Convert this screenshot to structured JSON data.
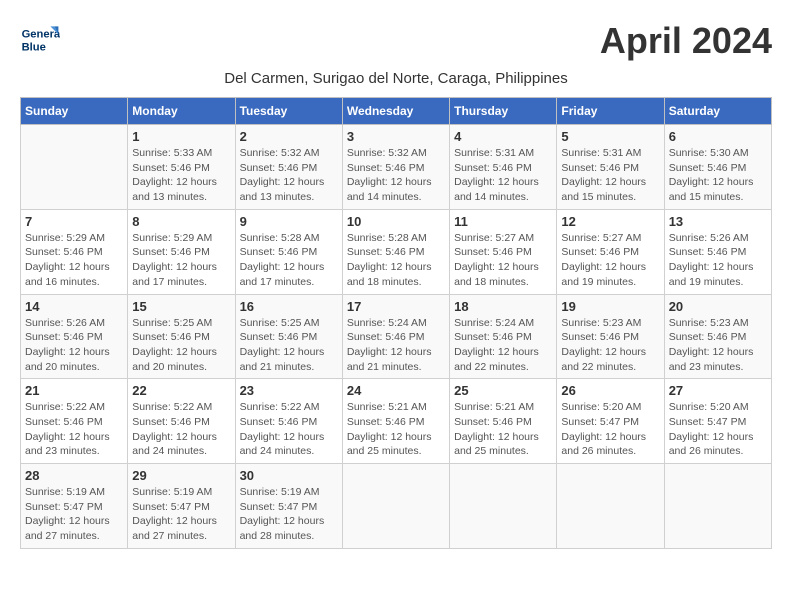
{
  "header": {
    "logo_line1": "General",
    "logo_line2": "Blue",
    "month_title": "April 2024",
    "location": "Del Carmen, Surigao del Norte, Caraga, Philippines"
  },
  "weekdays": [
    "Sunday",
    "Monday",
    "Tuesday",
    "Wednesday",
    "Thursday",
    "Friday",
    "Saturday"
  ],
  "weeks": [
    [
      {
        "day": "",
        "info": ""
      },
      {
        "day": "1",
        "info": "Sunrise: 5:33 AM\nSunset: 5:46 PM\nDaylight: 12 hours\nand 13 minutes."
      },
      {
        "day": "2",
        "info": "Sunrise: 5:32 AM\nSunset: 5:46 PM\nDaylight: 12 hours\nand 13 minutes."
      },
      {
        "day": "3",
        "info": "Sunrise: 5:32 AM\nSunset: 5:46 PM\nDaylight: 12 hours\nand 14 minutes."
      },
      {
        "day": "4",
        "info": "Sunrise: 5:31 AM\nSunset: 5:46 PM\nDaylight: 12 hours\nand 14 minutes."
      },
      {
        "day": "5",
        "info": "Sunrise: 5:31 AM\nSunset: 5:46 PM\nDaylight: 12 hours\nand 15 minutes."
      },
      {
        "day": "6",
        "info": "Sunrise: 5:30 AM\nSunset: 5:46 PM\nDaylight: 12 hours\nand 15 minutes."
      }
    ],
    [
      {
        "day": "7",
        "info": "Sunrise: 5:29 AM\nSunset: 5:46 PM\nDaylight: 12 hours\nand 16 minutes."
      },
      {
        "day": "8",
        "info": "Sunrise: 5:29 AM\nSunset: 5:46 PM\nDaylight: 12 hours\nand 17 minutes."
      },
      {
        "day": "9",
        "info": "Sunrise: 5:28 AM\nSunset: 5:46 PM\nDaylight: 12 hours\nand 17 minutes."
      },
      {
        "day": "10",
        "info": "Sunrise: 5:28 AM\nSunset: 5:46 PM\nDaylight: 12 hours\nand 18 minutes."
      },
      {
        "day": "11",
        "info": "Sunrise: 5:27 AM\nSunset: 5:46 PM\nDaylight: 12 hours\nand 18 minutes."
      },
      {
        "day": "12",
        "info": "Sunrise: 5:27 AM\nSunset: 5:46 PM\nDaylight: 12 hours\nand 19 minutes."
      },
      {
        "day": "13",
        "info": "Sunrise: 5:26 AM\nSunset: 5:46 PM\nDaylight: 12 hours\nand 19 minutes."
      }
    ],
    [
      {
        "day": "14",
        "info": "Sunrise: 5:26 AM\nSunset: 5:46 PM\nDaylight: 12 hours\nand 20 minutes."
      },
      {
        "day": "15",
        "info": "Sunrise: 5:25 AM\nSunset: 5:46 PM\nDaylight: 12 hours\nand 20 minutes."
      },
      {
        "day": "16",
        "info": "Sunrise: 5:25 AM\nSunset: 5:46 PM\nDaylight: 12 hours\nand 21 minutes."
      },
      {
        "day": "17",
        "info": "Sunrise: 5:24 AM\nSunset: 5:46 PM\nDaylight: 12 hours\nand 21 minutes."
      },
      {
        "day": "18",
        "info": "Sunrise: 5:24 AM\nSunset: 5:46 PM\nDaylight: 12 hours\nand 22 minutes."
      },
      {
        "day": "19",
        "info": "Sunrise: 5:23 AM\nSunset: 5:46 PM\nDaylight: 12 hours\nand 22 minutes."
      },
      {
        "day": "20",
        "info": "Sunrise: 5:23 AM\nSunset: 5:46 PM\nDaylight: 12 hours\nand 23 minutes."
      }
    ],
    [
      {
        "day": "21",
        "info": "Sunrise: 5:22 AM\nSunset: 5:46 PM\nDaylight: 12 hours\nand 23 minutes."
      },
      {
        "day": "22",
        "info": "Sunrise: 5:22 AM\nSunset: 5:46 PM\nDaylight: 12 hours\nand 24 minutes."
      },
      {
        "day": "23",
        "info": "Sunrise: 5:22 AM\nSunset: 5:46 PM\nDaylight: 12 hours\nand 24 minutes."
      },
      {
        "day": "24",
        "info": "Sunrise: 5:21 AM\nSunset: 5:46 PM\nDaylight: 12 hours\nand 25 minutes."
      },
      {
        "day": "25",
        "info": "Sunrise: 5:21 AM\nSunset: 5:46 PM\nDaylight: 12 hours\nand 25 minutes."
      },
      {
        "day": "26",
        "info": "Sunrise: 5:20 AM\nSunset: 5:47 PM\nDaylight: 12 hours\nand 26 minutes."
      },
      {
        "day": "27",
        "info": "Sunrise: 5:20 AM\nSunset: 5:47 PM\nDaylight: 12 hours\nand 26 minutes."
      }
    ],
    [
      {
        "day": "28",
        "info": "Sunrise: 5:19 AM\nSunset: 5:47 PM\nDaylight: 12 hours\nand 27 minutes."
      },
      {
        "day": "29",
        "info": "Sunrise: 5:19 AM\nSunset: 5:47 PM\nDaylight: 12 hours\nand 27 minutes."
      },
      {
        "day": "30",
        "info": "Sunrise: 5:19 AM\nSunset: 5:47 PM\nDaylight: 12 hours\nand 28 minutes."
      },
      {
        "day": "",
        "info": ""
      },
      {
        "day": "",
        "info": ""
      },
      {
        "day": "",
        "info": ""
      },
      {
        "day": "",
        "info": ""
      }
    ]
  ]
}
